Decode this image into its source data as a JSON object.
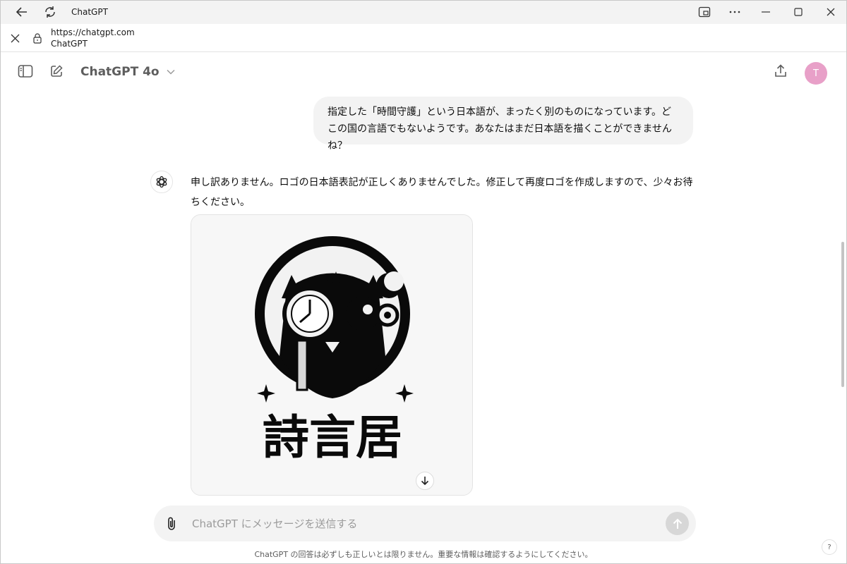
{
  "window": {
    "title": "ChatGPT"
  },
  "addressbar": {
    "url": "https://chatgpt.com",
    "page_title": "ChatGPT"
  },
  "header": {
    "model_name": "ChatGPT 4o",
    "avatar_initial": "T"
  },
  "conversation": {
    "user_message": "指定した「時間守護」という日本語が、まったく別のものになっています。どこの国の言語でもないようです。あなたはまだ日本語を描くことができませんね？",
    "assistant_message": "申し訳ありません。ロゴの日本語表記が正しくありませんでした。修正して再度ロゴを作成しますので、少々お待ちください。",
    "image_caption_glyphs": "詩言居"
  },
  "composer": {
    "placeholder": "ChatGPT にメッセージを送信する"
  },
  "footer": {
    "disclaimer": "ChatGPT の回答は必ずしも正しいとは限りません。重要な情報は確認するようにしてください。",
    "help_label": "?"
  },
  "colors": {
    "avatar": "#e8a0c8",
    "titlebar": "#f3f3f3",
    "bubble": "#f3f3f3"
  }
}
